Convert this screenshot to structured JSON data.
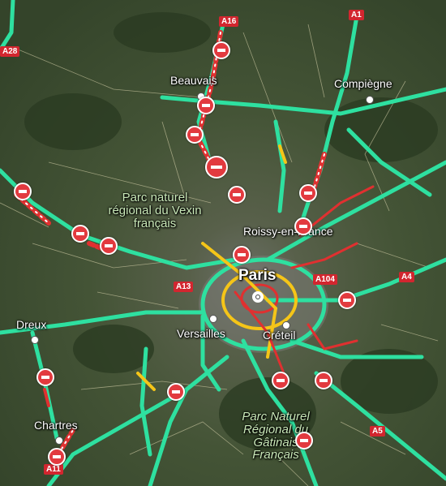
{
  "map": {
    "colors": {
      "free_flow": "#2ee0a0",
      "slow": "#f5c518",
      "congested": "#e03030",
      "closure": "#e23a3f"
    },
    "cities": {
      "beauvais": "Beauvais",
      "compiegne": "Compiègne",
      "roissy": "Roissy-en-France",
      "paris": "Paris",
      "versailles": "Versailles",
      "creteil": "Créteil",
      "dreux": "Dreux",
      "chartres": "Chartres"
    },
    "parks": {
      "vexin": "Parc naturel régional du Vexin français",
      "gatinais": "Parc Naturel Régional du Gâtinais Français"
    },
    "road_shields": {
      "a16": "A16",
      "a1": "A1",
      "a28": "A28",
      "a13": "A13",
      "a104": "A104",
      "a4": "A4",
      "a5": "A5",
      "a11": "A11"
    },
    "icons": {
      "closure": "road-closure-icon",
      "center": "city-center-icon"
    }
  }
}
